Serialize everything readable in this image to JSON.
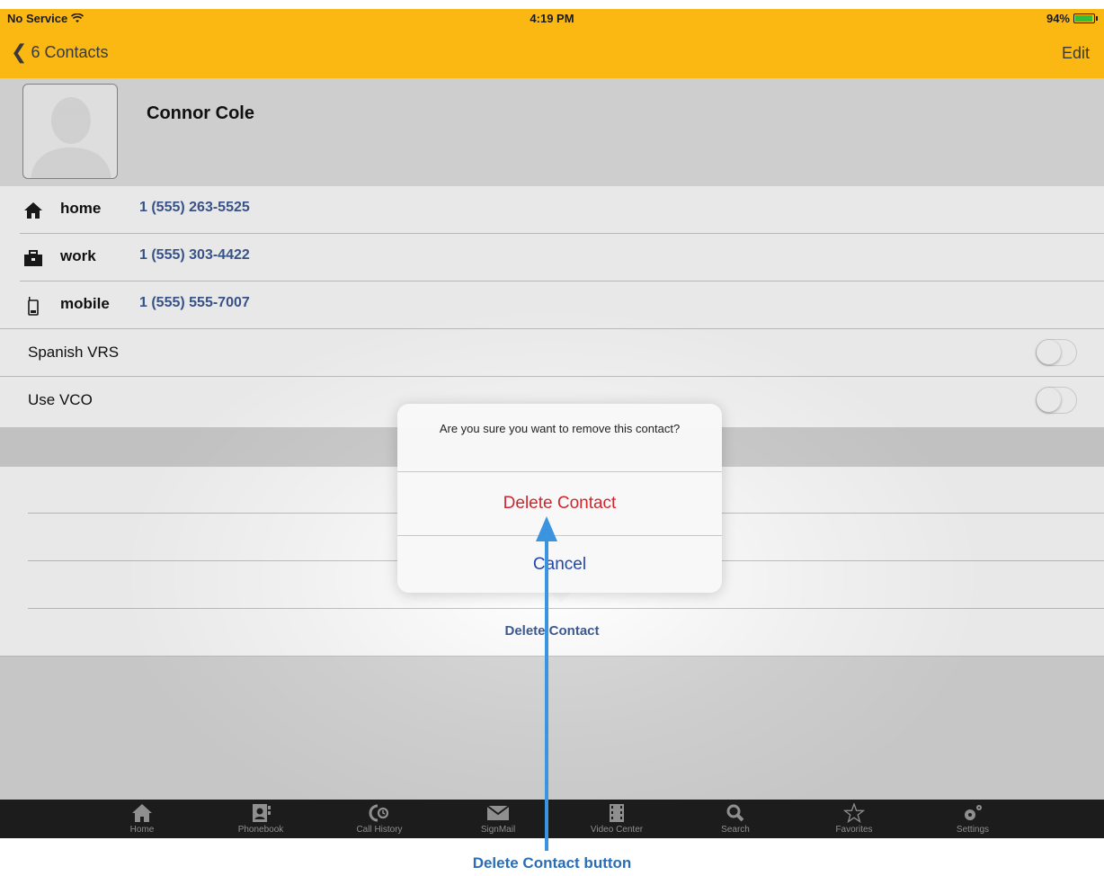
{
  "status_bar": {
    "carrier": "No Service",
    "time": "4:19 PM",
    "battery": "94%",
    "battery_level": 0.94
  },
  "nav": {
    "back_label": "6 Contacts",
    "edit_label": "Edit"
  },
  "contact": {
    "name": "Connor Cole"
  },
  "phones": [
    {
      "label": "home",
      "number": "1 (555) 263-5525",
      "icon": "house-icon"
    },
    {
      "label": "work",
      "number": "1 (555) 303-4422",
      "icon": "briefcase-icon"
    },
    {
      "label": "mobile",
      "number": "1 (555) 555-7007",
      "icon": "mobile-phone-icon"
    }
  ],
  "settings": [
    {
      "label": "Spanish VRS",
      "on": false
    },
    {
      "label": "Use VCO",
      "on": false
    }
  ],
  "delete_link": "Delete Contact",
  "alert": {
    "message": "Are you sure you want to remove this contact?",
    "delete_label": "Delete Contact",
    "cancel_label": "Cancel"
  },
  "tabs": [
    {
      "label": "Home",
      "icon": "home-icon"
    },
    {
      "label": "Phonebook",
      "icon": "phonebook-icon"
    },
    {
      "label": "Call History",
      "icon": "call-history-icon"
    },
    {
      "label": "SignMail",
      "icon": "envelope-icon"
    },
    {
      "label": "Video Center",
      "icon": "film-icon"
    },
    {
      "label": "Search",
      "icon": "search-icon"
    },
    {
      "label": "Favorites",
      "icon": "star-icon"
    },
    {
      "label": "Settings",
      "icon": "gear-icon"
    }
  ],
  "callout": {
    "label": "Delete Contact button"
  },
  "colors": {
    "accent_bar": "#fbb813",
    "destructive": "#d0262e",
    "link": "#1e47b3",
    "callout": "#3b94e0"
  }
}
